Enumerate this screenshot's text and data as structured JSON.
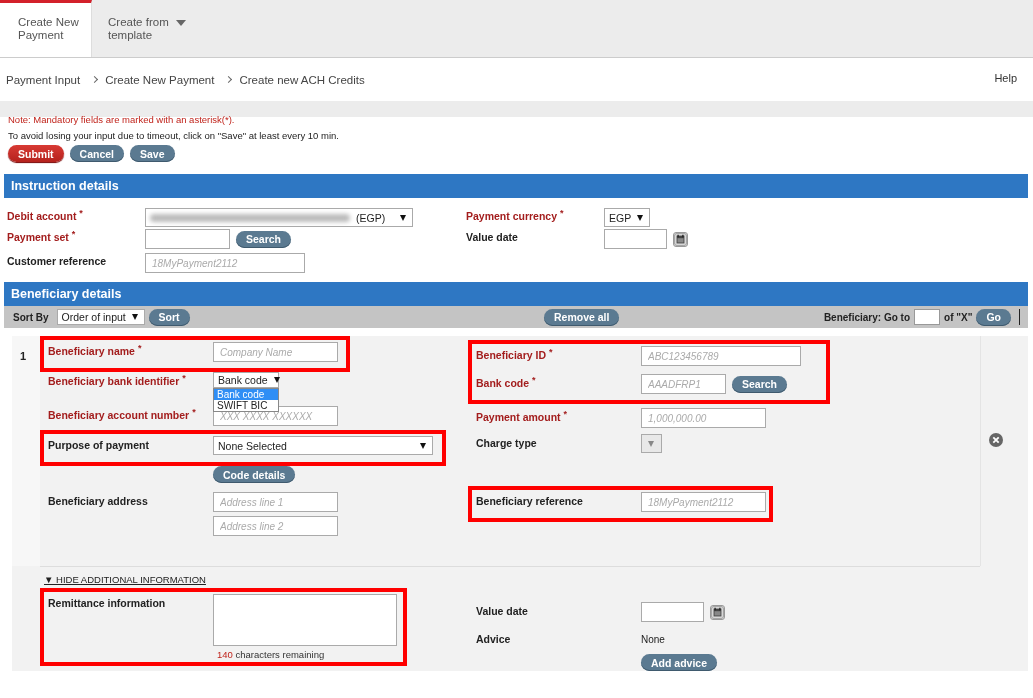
{
  "tabs": [
    {
      "label": "Create New Payment",
      "selected": true,
      "has_menu": false
    },
    {
      "label": "Create from template",
      "selected": false,
      "has_menu": true
    }
  ],
  "breadcrumb": [
    "Payment Input",
    "Create New Payment",
    "Create new ACH Credits"
  ],
  "help_link": "Help",
  "note": "Note: Mandatory fields are marked with an asterisk(*).",
  "timeout_hint": "To avoid losing your input due to timeout, click on \"Save\" at least every 10 min.",
  "actions": [
    {
      "label": "Submit",
      "kind": "primary"
    },
    {
      "label": "Cancel",
      "kind": "secondary"
    },
    {
      "label": "Save",
      "kind": "secondary"
    }
  ],
  "instruction_details": {
    "title": "Instruction details",
    "left": [
      {
        "label": "Debit account $^{*}$",
        "required": true,
        "kind": "wide-select",
        "redacted": true,
        "value": "(EGP)"
      },
      {
        "label": "Payment set $^{*}$",
        "required": true,
        "kind": "short-text",
        "button": {
          "label": "Search",
          "kind": "secondary"
        }
      },
      {
        "label": "Customer reference",
        "required": false,
        "kind": "long-text",
        "placeholder": "18MyPayment2112"
      }
    ],
    "right": [
      {
        "label": "Payment currency $^{*}$",
        "required": true,
        "kind": "select",
        "value": "EGP"
      },
      {
        "label": "Value date",
        "required": false,
        "kind": "date"
      }
    ]
  },
  "beneficiary_details": {
    "title": "Beneficiary details",
    "sort_label": "Sort By",
    "sort_select": "Order of input",
    "sort_button": "Sort",
    "remove_all": "Remove all",
    "goto_label": "Beneficiary: Go to",
    "goto_of": "of \"X\"",
    "goto_button": "Go",
    "beneficiaries": [
      {
        "number": "1",
        "left": [
          {
            "highlighted": true,
            "fields": [
              {
                "label": "Beneficiary name $^{*}$",
                "required": true,
                "kind": "text",
                "placeholder": "Company Name"
              }
            ]
          },
          {
            "highlighted": false,
            "fields": [
              {
                "label": "Beneficiary bank identifier $^{*}$",
                "required": true,
                "kind": "small-select",
                "value": "Bank code",
                "options": [
                  {
                    "label": "Bank code",
                    "selected": true
                  },
                  {
                    "label": "SWIFT BIC",
                    "selected": false
                  }
                ]
              },
              {
                "label": "Beneficiary account number $^{*}$",
                "required": true,
                "kind": "text",
                "placeholder": "XXX XXXX XXXXXX"
              }
            ]
          },
          {
            "highlighted": true,
            "fields": [
              {
                "label": "Purpose of payment",
                "required": false,
                "kind": "wide-select",
                "value": "None Selected"
              }
            ]
          },
          {
            "highlighted": false,
            "fields": [
              {
                "kind": "button",
                "button": {
                  "label": "Code details",
                  "kind": "secondary"
                }
              },
              {
                "label": "Beneficiary address",
                "required": false,
                "kind": "text",
                "placeholder": "Address line 1"
              },
              {
                "kind": "text",
                "placeholder": "Address line 2"
              }
            ]
          }
        ],
        "right": [
          {
            "highlighted": true,
            "fields": [
              {
                "label": "Beneficiary ID $^{*}$",
                "required": true,
                "kind": "long-text",
                "placeholder": "ABC123456789"
              },
              {
                "label": "Bank code $^{*}$",
                "required": true,
                "kind": "short-text",
                "placeholder": "AAADFRP1",
                "button": {
                  "label": "Search",
                  "kind": "secondary"
                }
              }
            ]
          },
          {
            "highlighted": false,
            "fields": [
              {
                "label": "Payment amount $^{*}$",
                "required": true,
                "kind": "text",
                "placeholder": "1,000,000.00"
              },
              {
                "label": "Charge type",
                "required": false,
                "kind": "tiny-select",
                "disabled": true
              }
            ]
          },
          {
            "highlighted": true,
            "fields": [
              {
                "label": "Beneficiary reference",
                "required": false,
                "kind": "text",
                "placeholder": "18MyPayment2112"
              }
            ]
          }
        ],
        "additional": {
          "toggle": "▼ HIDE ADDITIONAL INFORMATION",
          "expanded": true,
          "left": [
            {
              "highlighted": true,
              "fields": [
                {
                  "label": "Remittance information",
                  "required": false,
                  "kind": "textarea",
                  "counter": {
                    "count": "140",
                    "text": "characters remaining"
                  }
                }
              ]
            }
          ],
          "right": [
            {
              "highlighted": false,
              "fields": [
                {
                  "label": "Value date",
                  "required": false,
                  "kind": "date"
                },
                {
                  "label": "Advice",
                  "required": false,
                  "kind": "static",
                  "value": "None"
                },
                {
                  "kind": "button",
                  "button": {
                    "label": "Add advice",
                    "kind": "secondary"
                  }
                }
              ]
            }
          ]
        }
      }
    ]
  }
}
